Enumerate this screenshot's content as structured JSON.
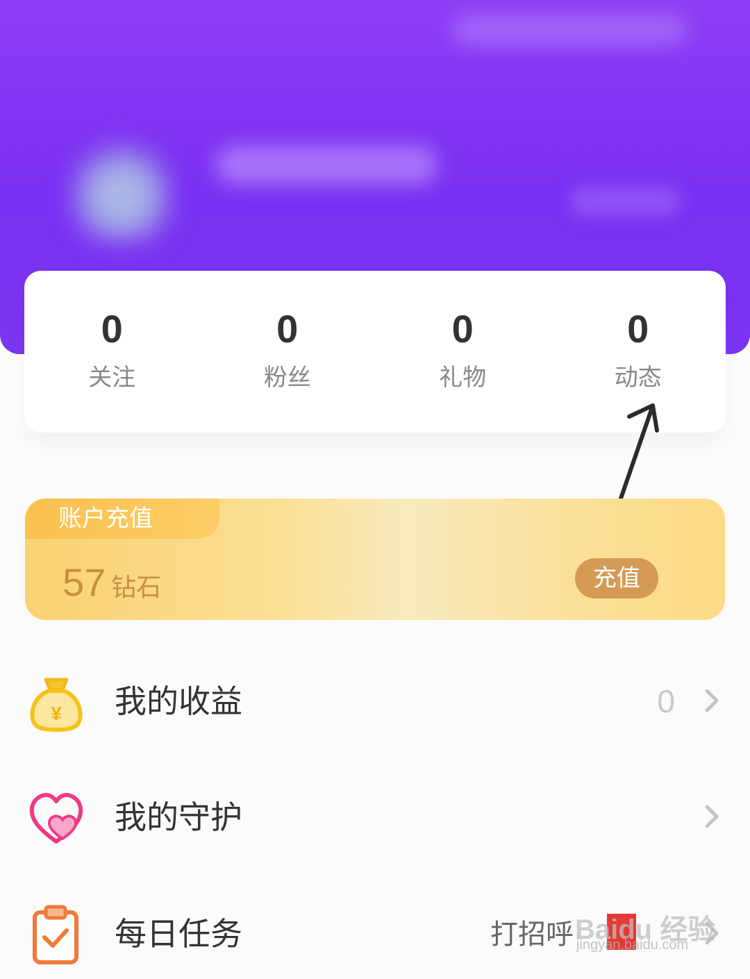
{
  "stats": [
    {
      "value": "0",
      "label": "关注"
    },
    {
      "value": "0",
      "label": "粉丝"
    },
    {
      "value": "0",
      "label": "礼物"
    },
    {
      "value": "0",
      "label": "动态"
    }
  ],
  "recharge": {
    "tag": "账户充值",
    "balance_value": "57",
    "balance_unit": "钻石",
    "button_label": "充值"
  },
  "menu": {
    "earnings": {
      "label": "我的收益",
      "value": "0"
    },
    "guard": {
      "label": "我的守护"
    },
    "tasks": {
      "label": "每日任务",
      "extra": "打招呼"
    }
  },
  "watermark": {
    "brand": "Baidu 经验",
    "url": "jingyan.baidu.com"
  },
  "colors": {
    "header_purple": "#7a30f2",
    "recharge_gold": "#fbd273",
    "recharge_button": "#d59a55",
    "accent_pink": "#ee3b84",
    "accent_orange": "#f07a3a"
  },
  "icons": [
    "money-bag-icon",
    "heart-icon",
    "clipboard-check-icon",
    "chevron-right-icon",
    "annotation-arrow"
  ]
}
